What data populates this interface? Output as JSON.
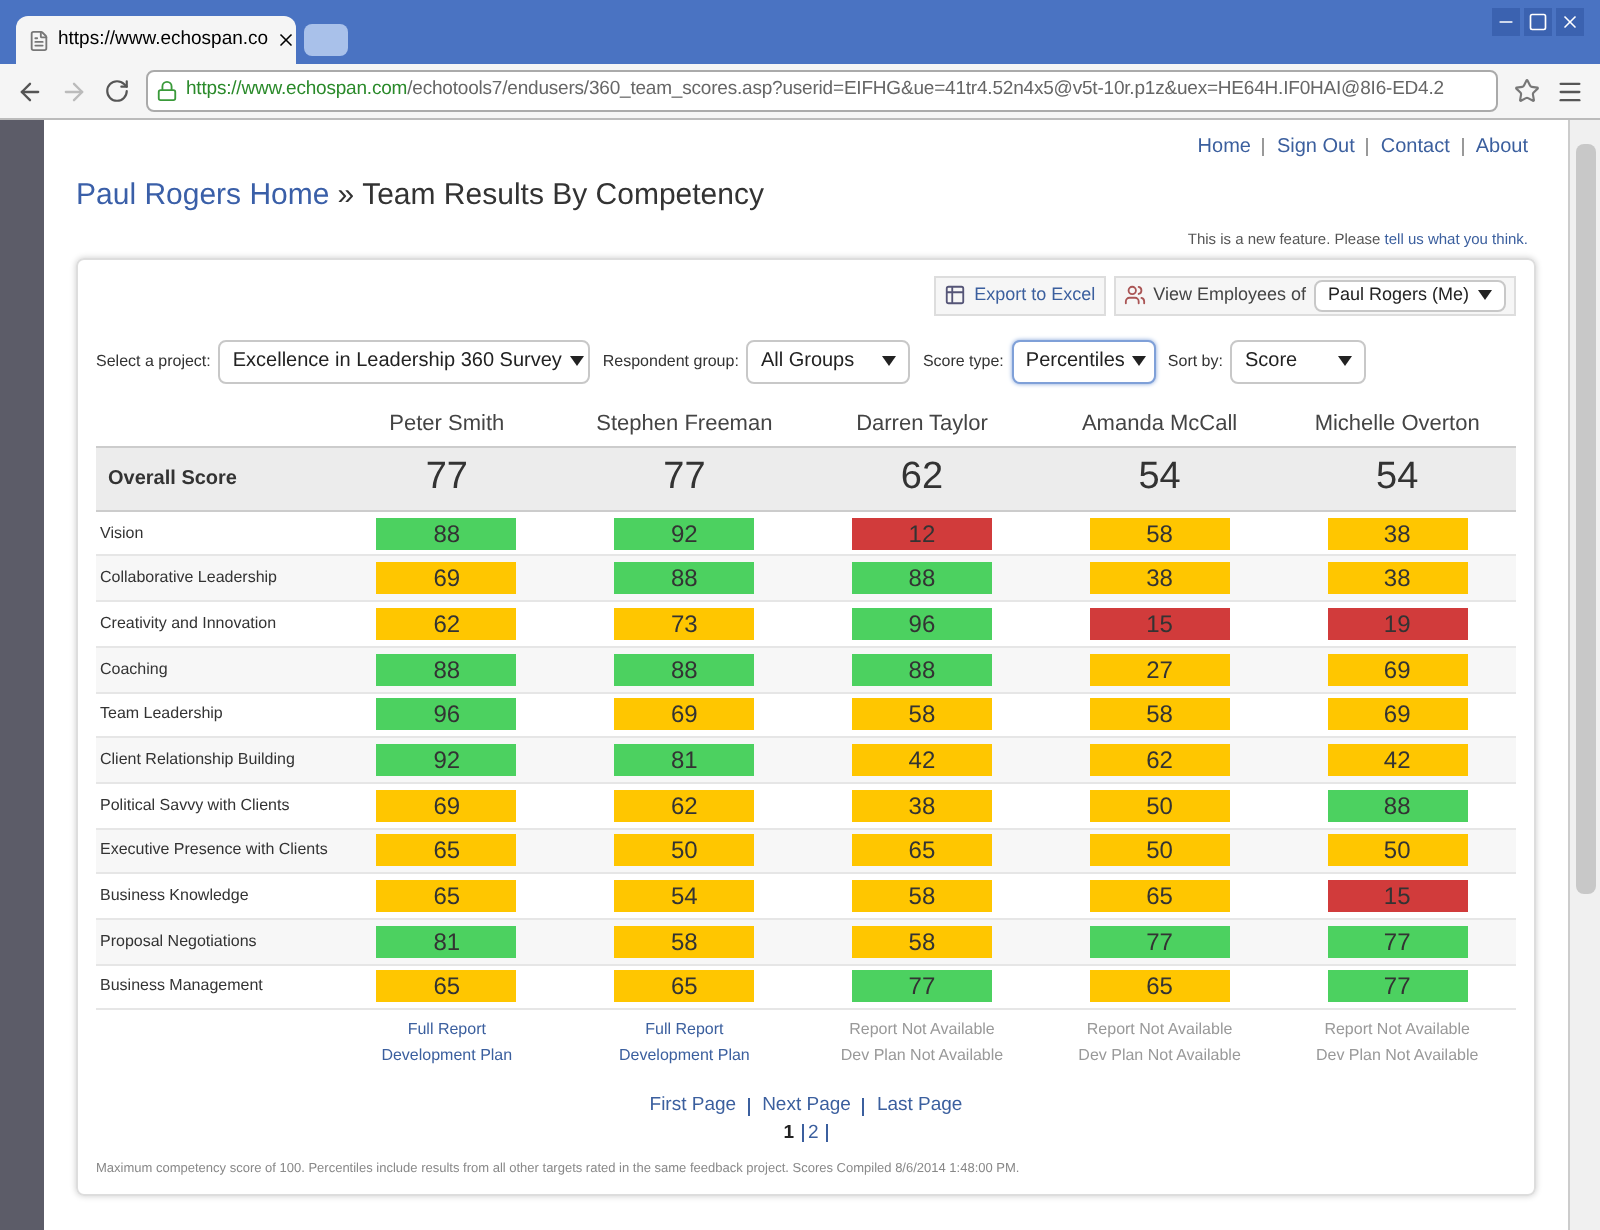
{
  "browser": {
    "tab_title": "https://www.echospan.co",
    "url_host": "https://www.echospan.com",
    "url_path": "/echotools7/endusers/360_team_scores.asp?userid=EIFHG&ue=41tr4.52n4x5@v5t-10r.p1z&uex=HE64H.IF0HAI@8I6-ED4.2"
  },
  "top_links": [
    "Home",
    "Sign Out",
    "Contact",
    "About"
  ],
  "breadcrumb": {
    "home": "Paul Rogers Home",
    "separator": "»",
    "current": "Team Results By Competency"
  },
  "feedback_note": {
    "text": "This is a new feature. Please",
    "link": "tell us what you think."
  },
  "toolbar": {
    "export": "Export to Excel",
    "view_label": "View Employees of",
    "view_value": "Paul Rogers (Me)"
  },
  "filters": [
    {
      "label": "Select a project:",
      "value": "Excellence in Leadership 360 Survey",
      "focused": false
    },
    {
      "label": "Respondent group:",
      "value": "All Groups",
      "focused": false
    },
    {
      "label": "Score type:",
      "value": "Percentiles",
      "focused": true
    },
    {
      "label": "Sort by:",
      "value": "Score",
      "focused": false
    }
  ],
  "table": {
    "people": [
      "Peter Smith",
      "Stephen Freeman",
      "Darren Taylor",
      "Amanda McCall",
      "Michelle Overton"
    ],
    "overall_label": "Overall Score",
    "overall": [
      "77",
      "77",
      "62",
      "54",
      "54"
    ],
    "rows": [
      {
        "name": "Vision",
        "scores": [
          {
            "value": "88",
            "color": "#4cd160"
          },
          {
            "value": "92",
            "color": "#4cd160"
          },
          {
            "value": "12",
            "color": "#d13b3b"
          },
          {
            "value": "58",
            "color": "#ffc600"
          },
          {
            "value": "38",
            "color": "#ffc600"
          }
        ]
      },
      {
        "name": "Collaborative Leadership",
        "scores": [
          {
            "value": "69",
            "color": "#ffc600"
          },
          {
            "value": "88",
            "color": "#4cd160"
          },
          {
            "value": "88",
            "color": "#4cd160"
          },
          {
            "value": "38",
            "color": "#ffc600"
          },
          {
            "value": "38",
            "color": "#ffc600"
          }
        ]
      },
      {
        "name": "Creativity and Innovation",
        "scores": [
          {
            "value": "62",
            "color": "#ffc600"
          },
          {
            "value": "73",
            "color": "#ffc600"
          },
          {
            "value": "96",
            "color": "#4cd160"
          },
          {
            "value": "15",
            "color": "#d13b3b"
          },
          {
            "value": "19",
            "color": "#d13b3b"
          }
        ]
      },
      {
        "name": "Coaching",
        "scores": [
          {
            "value": "88",
            "color": "#4cd160"
          },
          {
            "value": "88",
            "color": "#4cd160"
          },
          {
            "value": "88",
            "color": "#4cd160"
          },
          {
            "value": "27",
            "color": "#ffc600"
          },
          {
            "value": "69",
            "color": "#ffc600"
          }
        ]
      },
      {
        "name": "Team Leadership",
        "scores": [
          {
            "value": "96",
            "color": "#4cd160"
          },
          {
            "value": "69",
            "color": "#ffc600"
          },
          {
            "value": "58",
            "color": "#ffc600"
          },
          {
            "value": "58",
            "color": "#ffc600"
          },
          {
            "value": "69",
            "color": "#ffc600"
          }
        ]
      },
      {
        "name": "Client Relationship Building",
        "scores": [
          {
            "value": "92",
            "color": "#4cd160"
          },
          {
            "value": "81",
            "color": "#4cd160"
          },
          {
            "value": "42",
            "color": "#ffc600"
          },
          {
            "value": "62",
            "color": "#ffc600"
          },
          {
            "value": "42",
            "color": "#ffc600"
          }
        ]
      },
      {
        "name": "Political Savvy with Clients",
        "scores": [
          {
            "value": "69",
            "color": "#ffc600"
          },
          {
            "value": "62",
            "color": "#ffc600"
          },
          {
            "value": "38",
            "color": "#ffc600"
          },
          {
            "value": "50",
            "color": "#ffc600"
          },
          {
            "value": "88",
            "color": "#4cd160"
          }
        ]
      },
      {
        "name": "Executive Presence with Clients",
        "scores": [
          {
            "value": "65",
            "color": "#ffc600"
          },
          {
            "value": "50",
            "color": "#ffc600"
          },
          {
            "value": "65",
            "color": "#ffc600"
          },
          {
            "value": "50",
            "color": "#ffc600"
          },
          {
            "value": "50",
            "color": "#ffc600"
          }
        ]
      },
      {
        "name": "Business Knowledge",
        "scores": [
          {
            "value": "65",
            "color": "#ffc600"
          },
          {
            "value": "54",
            "color": "#ffc600"
          },
          {
            "value": "58",
            "color": "#ffc600"
          },
          {
            "value": "65",
            "color": "#ffc600"
          },
          {
            "value": "15",
            "color": "#d13b3b"
          }
        ]
      },
      {
        "name": "Proposal Negotiations",
        "scores": [
          {
            "value": "81",
            "color": "#4cd160"
          },
          {
            "value": "58",
            "color": "#ffc600"
          },
          {
            "value": "58",
            "color": "#ffc600"
          },
          {
            "value": "77",
            "color": "#4cd160"
          },
          {
            "value": "77",
            "color": "#4cd160"
          }
        ]
      },
      {
        "name": "Business Management",
        "scores": [
          {
            "value": "65",
            "color": "#ffc600"
          },
          {
            "value": "65",
            "color": "#ffc600"
          },
          {
            "value": "77",
            "color": "#4cd160"
          },
          {
            "value": "65",
            "color": "#ffc600"
          },
          {
            "value": "77",
            "color": "#4cd160"
          }
        ]
      }
    ],
    "reports": [
      [
        {
          "text": "Full Report",
          "available": true
        },
        {
          "text": "Development Plan",
          "available": true
        }
      ],
      [
        {
          "text": "Full Report",
          "available": true
        },
        {
          "text": "Development Plan",
          "available": true
        }
      ],
      [
        {
          "text": "Report Not Available",
          "available": false
        },
        {
          "text": "Dev Plan Not Available",
          "available": false
        }
      ],
      [
        {
          "text": "Report Not Available",
          "available": false
        },
        {
          "text": "Dev Plan Not Available",
          "available": false
        }
      ],
      [
        {
          "text": "Report Not Available",
          "available": false
        },
        {
          "text": "Dev Plan Not Available",
          "available": false
        }
      ]
    ]
  },
  "pager": {
    "links": [
      "First Page",
      "Next Page",
      "Last Page"
    ],
    "pages": [
      {
        "label": "1",
        "selected": true
      },
      {
        "label": "2",
        "selected": false
      }
    ]
  },
  "footnote": "Maximum competency score of 100. Percentiles include results from all other targets rated in the same feedback project. Scores Compiled 8/6/2014 1:48:00 PM."
}
